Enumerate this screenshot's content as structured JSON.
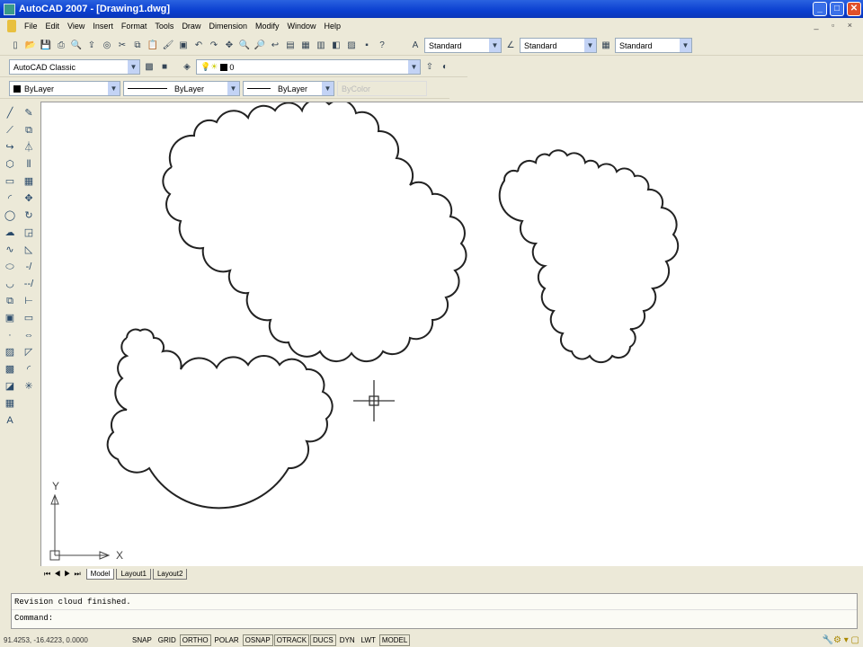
{
  "window": {
    "title": "AutoCAD 2007 - [Drawing1.dwg]",
    "min": "_",
    "max": "□",
    "close": "✕"
  },
  "menu": [
    "File",
    "Edit",
    "View",
    "Insert",
    "Format",
    "Tools",
    "Draw",
    "Dimension",
    "Modify",
    "Window",
    "Help"
  ],
  "styles": {
    "text_style": "Standard",
    "dim_style": "Standard",
    "table_style": "Standard"
  },
  "workspace": "AutoCAD Classic",
  "layer": "0",
  "properties": {
    "color": "ByLayer",
    "linetype": "ByLayer",
    "lineweight": "ByLayer",
    "plotstyle": "ByColor"
  },
  "tabs": [
    "Model",
    "Layout1",
    "Layout2"
  ],
  "command": {
    "history": "Revision cloud finished.",
    "prompt": "Command:"
  },
  "status": {
    "coords": "91.4253, -16.4223, 0.0000",
    "toggles": [
      "SNAP",
      "GRID",
      "ORTHO",
      "POLAR",
      "OSNAP",
      "OTRACK",
      "DUCS",
      "DYN",
      "LWT",
      "MODEL"
    ],
    "on": [
      "ORTHO",
      "OSNAP",
      "OTRACK",
      "DUCS",
      "MODEL"
    ]
  },
  "ucs": {
    "x": "X",
    "y": "Y"
  },
  "colors": {
    "title": "#0a3fd0",
    "ui": "#ece9d8"
  }
}
